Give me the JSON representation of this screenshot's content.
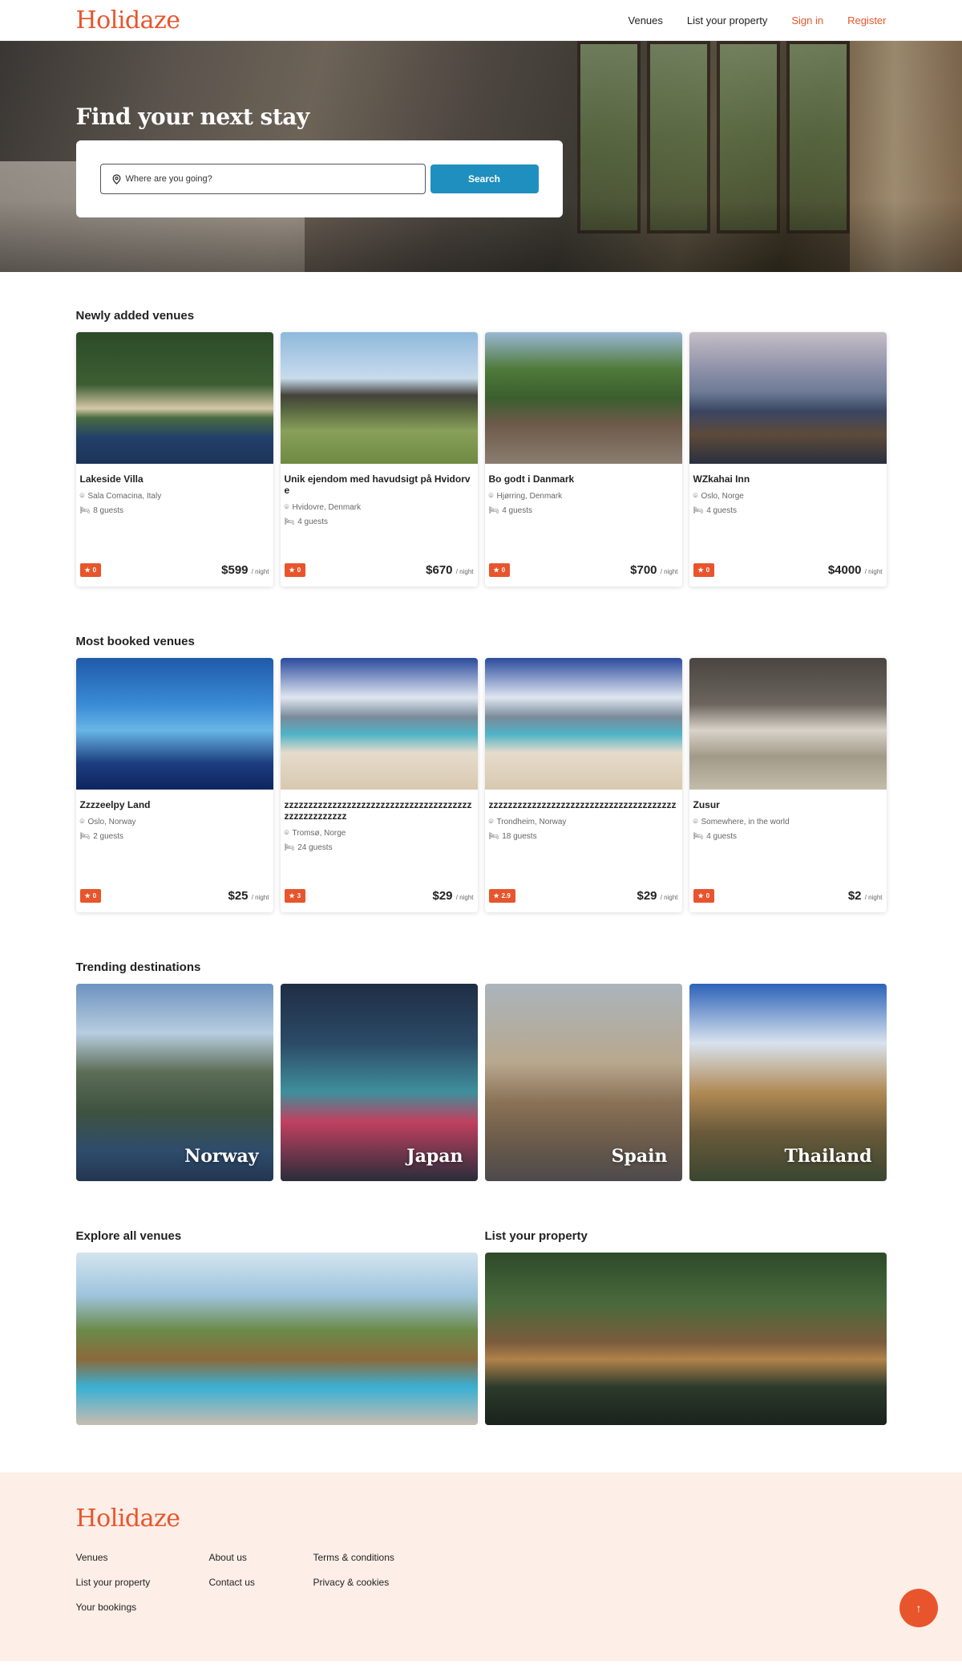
{
  "brand": "Holidaze",
  "nav": {
    "venues": "Venues",
    "list_property": "List your property",
    "sign_in": "Sign in",
    "register": "Register"
  },
  "hero": {
    "title": "Find your next stay",
    "search_placeholder": "Where are you going?",
    "search_button": "Search"
  },
  "newly_added": {
    "heading": "Newly added venues",
    "cards": [
      {
        "title": "Lakeside Villa",
        "location": "Sala Comacina, Italy",
        "guests": "8 guests",
        "rating": "0",
        "price": "$599",
        "per": "/ night"
      },
      {
        "title": "Unik ejendom med havudsigt på Hvidorve",
        "location": "Hvidovre, Denmark",
        "guests": "4 guests",
        "rating": "0",
        "price": "$670",
        "per": "/ night"
      },
      {
        "title": "Bo godt i Danmark",
        "location": "Hjørring, Denmark",
        "guests": "4 guests",
        "rating": "0",
        "price": "$700",
        "per": "/ night"
      },
      {
        "title": "WZkahai Inn",
        "location": "Oslo, Norge",
        "guests": "4 guests",
        "rating": "0",
        "price": "$4000",
        "per": "/ night"
      }
    ]
  },
  "most_booked": {
    "heading": "Most booked venues",
    "cards": [
      {
        "title": "Zzzzeelpy Land",
        "location": "Oslo, Norway",
        "guests": "2 guests",
        "rating": "0",
        "price": "$25",
        "per": "/ night"
      },
      {
        "title": "zzzzzzzzzzzzzzzzzzzzzzzzzzzzzzzzzzzzzzzzzzzzzzzzzzzz",
        "location": "Tromsø, Norge",
        "guests": "24 guests",
        "rating": "3",
        "price": "$29",
        "per": "/ night"
      },
      {
        "title": "zzzzzzzzzzzzzzzzzzzzzzzzzzzzzzzzzzzzzzz",
        "location": "Trondheim, Norway",
        "guests": "18 guests",
        "rating": "2.9",
        "price": "$29",
        "per": "/ night"
      },
      {
        "title": "Zusur",
        "location": "Somewhere, in the world",
        "guests": "4 guests",
        "rating": "0",
        "price": "$2",
        "per": "/ night"
      }
    ]
  },
  "trending": {
    "heading": "Trending destinations",
    "items": [
      "Norway",
      "Japan",
      "Spain",
      "Thailand"
    ]
  },
  "explore": {
    "heading": "Explore all venues"
  },
  "list_property": {
    "heading": "List your property"
  },
  "footer": {
    "col1": [
      "Venues",
      "List your property",
      "Your bookings"
    ],
    "col2": [
      "About us",
      "Contact us"
    ],
    "col3": [
      "Terms & conditions",
      "Privacy & cookies"
    ]
  },
  "colors": {
    "accent": "#e8552c",
    "search_button": "#1e8fbf",
    "footer_bg": "#fdeee7"
  }
}
